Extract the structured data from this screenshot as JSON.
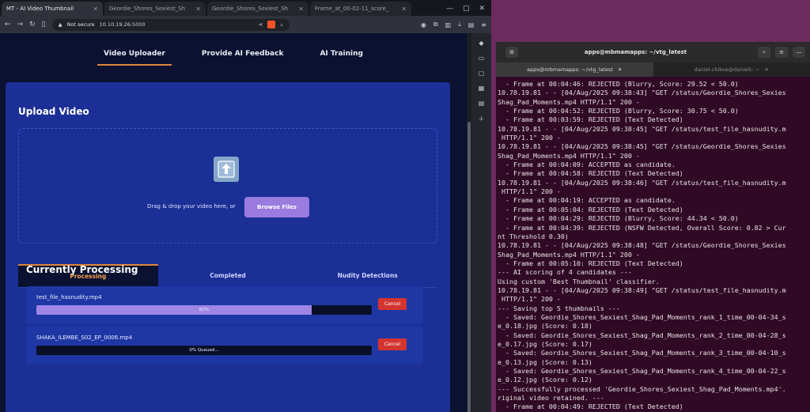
{
  "browser": {
    "tabs": [
      {
        "title": "MT - AI Video Thumbnail",
        "active": true
      },
      {
        "title": "Geordie_Shores_Sexiest_Sh",
        "active": false
      },
      {
        "title": "Geordie_Shores_Sexiest_Sh",
        "active": false
      },
      {
        "title": "Frame_at_00-02-11_score_",
        "active": false
      }
    ],
    "not_secure": "Not secure",
    "url": "10.10.19.26:5000"
  },
  "app": {
    "nav": [
      "Video Uploader",
      "Provide AI Feedback",
      "AI Training"
    ],
    "upload_title": "Upload Video",
    "drop_text": "Drag & drop your video here, or",
    "browse_label": "Browse Files",
    "tabs": [
      "Processing",
      "Completed",
      "Nudity Detections"
    ],
    "processing_title": "Currently Processing",
    "jobs": [
      {
        "name": "test_file_hasnudity.mp4",
        "progress": 0.82,
        "label": "82%",
        "cancel": "Cancel"
      },
      {
        "name": "SHAKA_ILEMBE_S02_EP_0006.mp4",
        "progress": 0.0,
        "label": "0% Queued...",
        "cancel": "Cancel"
      }
    ]
  },
  "terminal": {
    "title": "apps@mbmamapps: ~/vtg_latest",
    "tabs": [
      "apps@mbmamapps: ~/vtg_latest",
      "daniel-chikoe@danielc: ~"
    ],
    "lines": [
      "  - Frame at 00:04:46: REJECTED (Blurry, Score: 29.52 < 50.0)",
      "10.78.19.81 - - [04/Aug/2025 09:38:43] \"GET /status/Geordie_Shores_Sexies",
      "Shag_Pad_Moments.mp4 HTTP/1.1\" 200 -",
      "  - Frame at 00:04:52: REJECTED (Blurry, Score: 30.75 < 50.0)",
      "  - Frame at 00:03:59: REJECTED (Text Detected)",
      "10.78.19.81 - - [04/Aug/2025 09:38:45] \"GET /status/test_file_hasnudity.m",
      " HTTP/1.1\" 200 -",
      "10.78.19.81 - - [04/Aug/2025 09:38:45] \"GET /status/Geordie_Shores_Sexies",
      "Shag_Pad_Moments.mp4 HTTP/1.1\" 200 -",
      "  - Frame at 00:04:09: ACCEPTED as candidate.",
      "  - Frame at 00:04:58: REJECTED (Text Detected)",
      "10.78.19.81 - - [04/Aug/2025 09:38:46] \"GET /status/test_file_hasnudity.m",
      " HTTP/1.1\" 200 -",
      "  - Frame at 00:04:19: ACCEPTED as candidate.",
      "  - Frame at 00:05:04: REJECTED (Text Detected)",
      "  - Frame at 00:04:29: REJECTED (Blurry, Score: 44.34 < 50.0)",
      "  - Frame at 00:04:39: REJECTED (NSFW Detected, Overall Score: 0.82 > Cur",
      "nt Threshold 0.30)",
      "10.78.19.81 - - [04/Aug/2025 09:38:48] \"GET /status/Geordie_Shores_Sexies",
      "Shag_Pad_Moments.mp4 HTTP/1.1\" 200 -",
      "  - Frame at 00:05:10: REJECTED (Text Detected)",
      "--- AI scoring of 4 candidates ---",
      "Using custom 'Best Thumbnail' classifier.",
      "10.78.19.81 - - [04/Aug/2025 09:38:49] \"GET /status/test_file_hasnudity.m",
      " HTTP/1.1\" 200 -",
      "--- Saving top 5 thumbnails ---",
      "  - Saved: Geordie_Shores_Sexiest_Shag_Pad_Moments_rank_1_time_00-04-34_s",
      "e_0.18.jpg (Score: 0.18)",
      "  - Saved: Geordie_Shores_Sexiest_Shag_Pad_Moments_rank_2_time_00-04-28_s",
      "e_0.17.jpg (Score: 0.17)",
      "  - Saved: Geordie_Shores_Sexiest_Shag_Pad_Moments_rank_3_time_00-04-10_s",
      "e_0.13.jpg (Score: 0.13)",
      "  - Saved: Geordie_Shores_Sexiest_Shag_Pad_Moments_rank_4_time_00-04-22_s",
      "e_0.12.jpg (Score: 0.12)",
      "--- Successfully processed 'Geordie_Shores_Sexiest_Shag_Pad_Moments.mp4'.",
      "riginal video retained. ---",
      "  - Frame at 00:04:49: REJECTED (Text Detected)"
    ]
  },
  "colors": {
    "panel": "#1b2f96",
    "accent": "#e0873a",
    "browse": "#9a7be0",
    "progress": "#9d86e6",
    "cancel": "#d3342f",
    "terminal_bg": "#300a24"
  }
}
